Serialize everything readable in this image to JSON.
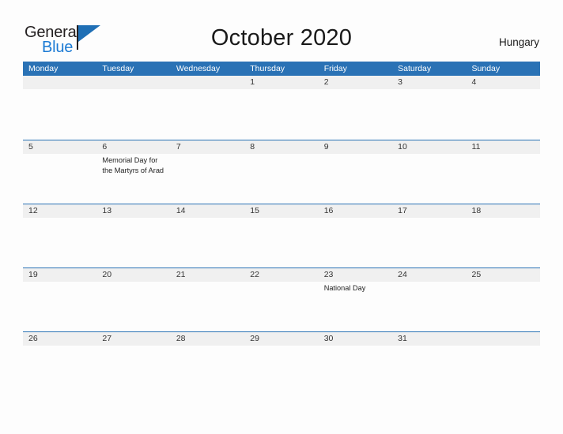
{
  "brand": {
    "name_part1": "General",
    "name_part2": "Blue",
    "flag_icon": "blue-flag-triangle"
  },
  "header": {
    "title": "October 2020",
    "country": "Hungary"
  },
  "calendar": {
    "day_headers": [
      "Monday",
      "Tuesday",
      "Wednesday",
      "Thursday",
      "Friday",
      "Saturday",
      "Sunday"
    ],
    "colors": {
      "header_background": "#2a72b5",
      "header_text": "#ffffff",
      "week_band": "#f0f0f0",
      "row_rule": "#2a72b5",
      "page_background": "#fdfdfd",
      "date_text": "#333333",
      "event_text": "#222222",
      "logo_blue": "#1b7ad4",
      "logo_dark": "#231f20"
    },
    "weeks": [
      {
        "days": [
          {
            "date": "",
            "events": []
          },
          {
            "date": "",
            "events": []
          },
          {
            "date": "",
            "events": []
          },
          {
            "date": "1",
            "events": []
          },
          {
            "date": "2",
            "events": []
          },
          {
            "date": "3",
            "events": []
          },
          {
            "date": "4",
            "events": []
          }
        ]
      },
      {
        "days": [
          {
            "date": "5",
            "events": []
          },
          {
            "date": "6",
            "events": [
              "Memorial Day for the Martyrs of Arad"
            ]
          },
          {
            "date": "7",
            "events": []
          },
          {
            "date": "8",
            "events": []
          },
          {
            "date": "9",
            "events": []
          },
          {
            "date": "10",
            "events": []
          },
          {
            "date": "11",
            "events": []
          }
        ]
      },
      {
        "days": [
          {
            "date": "12",
            "events": []
          },
          {
            "date": "13",
            "events": []
          },
          {
            "date": "14",
            "events": []
          },
          {
            "date": "15",
            "events": []
          },
          {
            "date": "16",
            "events": []
          },
          {
            "date": "17",
            "events": []
          },
          {
            "date": "18",
            "events": []
          }
        ]
      },
      {
        "days": [
          {
            "date": "19",
            "events": []
          },
          {
            "date": "20",
            "events": []
          },
          {
            "date": "21",
            "events": []
          },
          {
            "date": "22",
            "events": []
          },
          {
            "date": "23",
            "events": [
              "National Day"
            ]
          },
          {
            "date": "24",
            "events": []
          },
          {
            "date": "25",
            "events": []
          }
        ]
      },
      {
        "days": [
          {
            "date": "26",
            "events": []
          },
          {
            "date": "27",
            "events": []
          },
          {
            "date": "28",
            "events": []
          },
          {
            "date": "29",
            "events": []
          },
          {
            "date": "30",
            "events": []
          },
          {
            "date": "31",
            "events": []
          },
          {
            "date": "",
            "events": []
          }
        ]
      }
    ]
  }
}
